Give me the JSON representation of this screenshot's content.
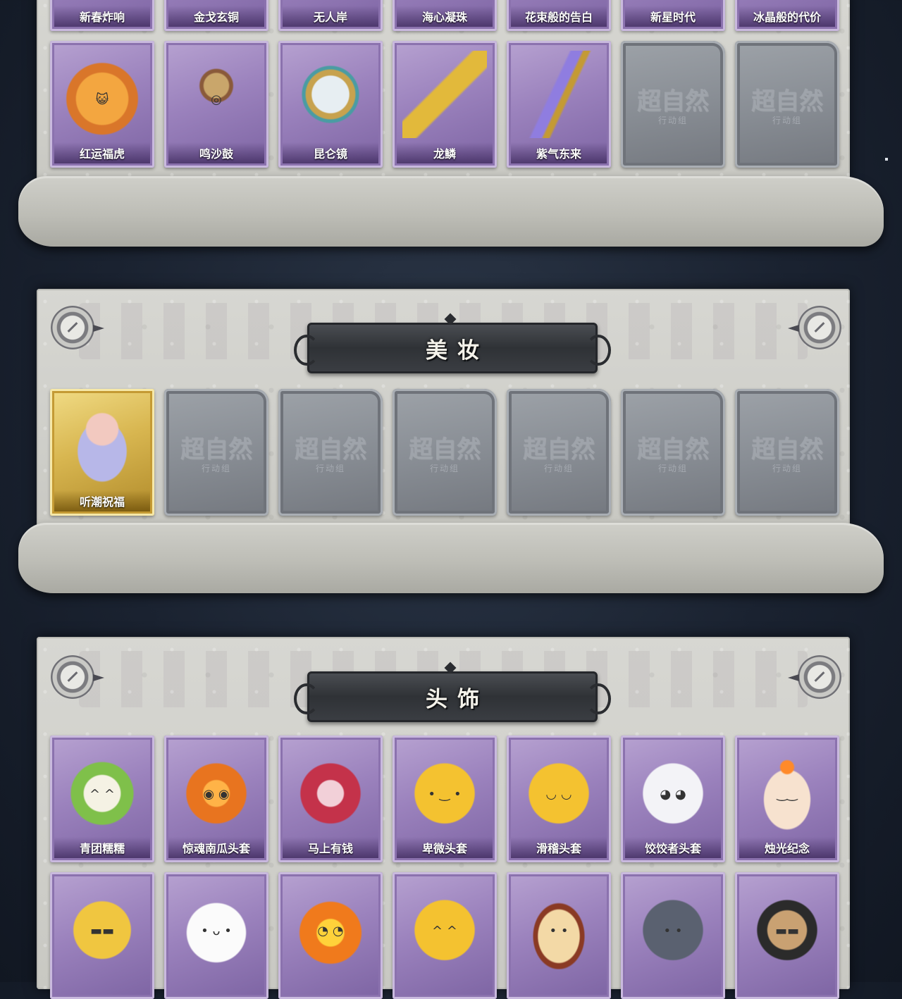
{
  "sections": {
    "top": {
      "row_a": [
        "新春炸响",
        "金戈玄铜",
        "无人岸",
        "海心凝珠",
        "花束般的告白",
        "新星时代",
        "冰晶般的代价"
      ],
      "row_b": [
        {
          "label": "红运福虎",
          "icon": "tiger-pillow-icon",
          "state": "owned"
        },
        {
          "label": "鸣沙鼓",
          "icon": "dreamcatcher-drum-icon",
          "state": "owned"
        },
        {
          "label": "昆仑镜",
          "icon": "ornate-mirror-icon",
          "state": "owned"
        },
        {
          "label": "龙鳞",
          "icon": "golden-shovel-icon",
          "state": "owned"
        },
        {
          "label": "紫气东来",
          "icon": "purple-blade-icon",
          "state": "owned"
        },
        {
          "label": "",
          "icon": "locked-placeholder-icon",
          "state": "locked"
        },
        {
          "label": "",
          "icon": "locked-placeholder-icon",
          "state": "locked"
        }
      ]
    },
    "makeup": {
      "title": "美妆",
      "items": [
        {
          "label": "听潮祝福",
          "icon": "winged-mannequin-icon",
          "state": "owned-gold"
        },
        {
          "label": "",
          "icon": "locked-placeholder-icon",
          "state": "locked"
        },
        {
          "label": "",
          "icon": "locked-placeholder-icon",
          "state": "locked"
        },
        {
          "label": "",
          "icon": "locked-placeholder-icon",
          "state": "locked"
        },
        {
          "label": "",
          "icon": "locked-placeholder-icon",
          "state": "locked"
        },
        {
          "label": "",
          "icon": "locked-placeholder-icon",
          "state": "locked"
        },
        {
          "label": "",
          "icon": "locked-placeholder-icon",
          "state": "locked"
        }
      ]
    },
    "headwear": {
      "title": "头饰",
      "row_a": [
        {
          "label": "青团糯糯",
          "icon": "green-dumpling-head-icon"
        },
        {
          "label": "惊魂南瓜头套",
          "icon": "pumpkin-head-icon"
        },
        {
          "label": "马上有钱",
          "icon": "red-horse-head-icon"
        },
        {
          "label": "卑微头套",
          "icon": "humble-emoji-head-icon"
        },
        {
          "label": "滑稽头套",
          "icon": "funny-emoji-head-icon"
        },
        {
          "label": "饺饺者头套",
          "icon": "dumpling-cloud-head-icon"
        },
        {
          "label": "烛光纪念",
          "icon": "candle-head-icon"
        }
      ],
      "row_b": [
        {
          "icon": "pikachu-sunglasses-head-icon"
        },
        {
          "icon": "white-mochi-head-icon"
        },
        {
          "icon": "fire-spirit-head-icon"
        },
        {
          "icon": "grinning-emoji-head-icon"
        },
        {
          "icon": "pudding-head-icon"
        },
        {
          "icon": "penguin-head-icon"
        },
        {
          "icon": "dog-sunglasses-head-icon"
        }
      ]
    }
  },
  "watermark": {
    "main": "超自然",
    "sub": "行动组"
  },
  "colors": {
    "card_purple": "#9b82bd",
    "card_gold": "#d8b650",
    "card_locked": "#878c93",
    "panel": "#d0d0cb",
    "background": "#1a2230"
  }
}
